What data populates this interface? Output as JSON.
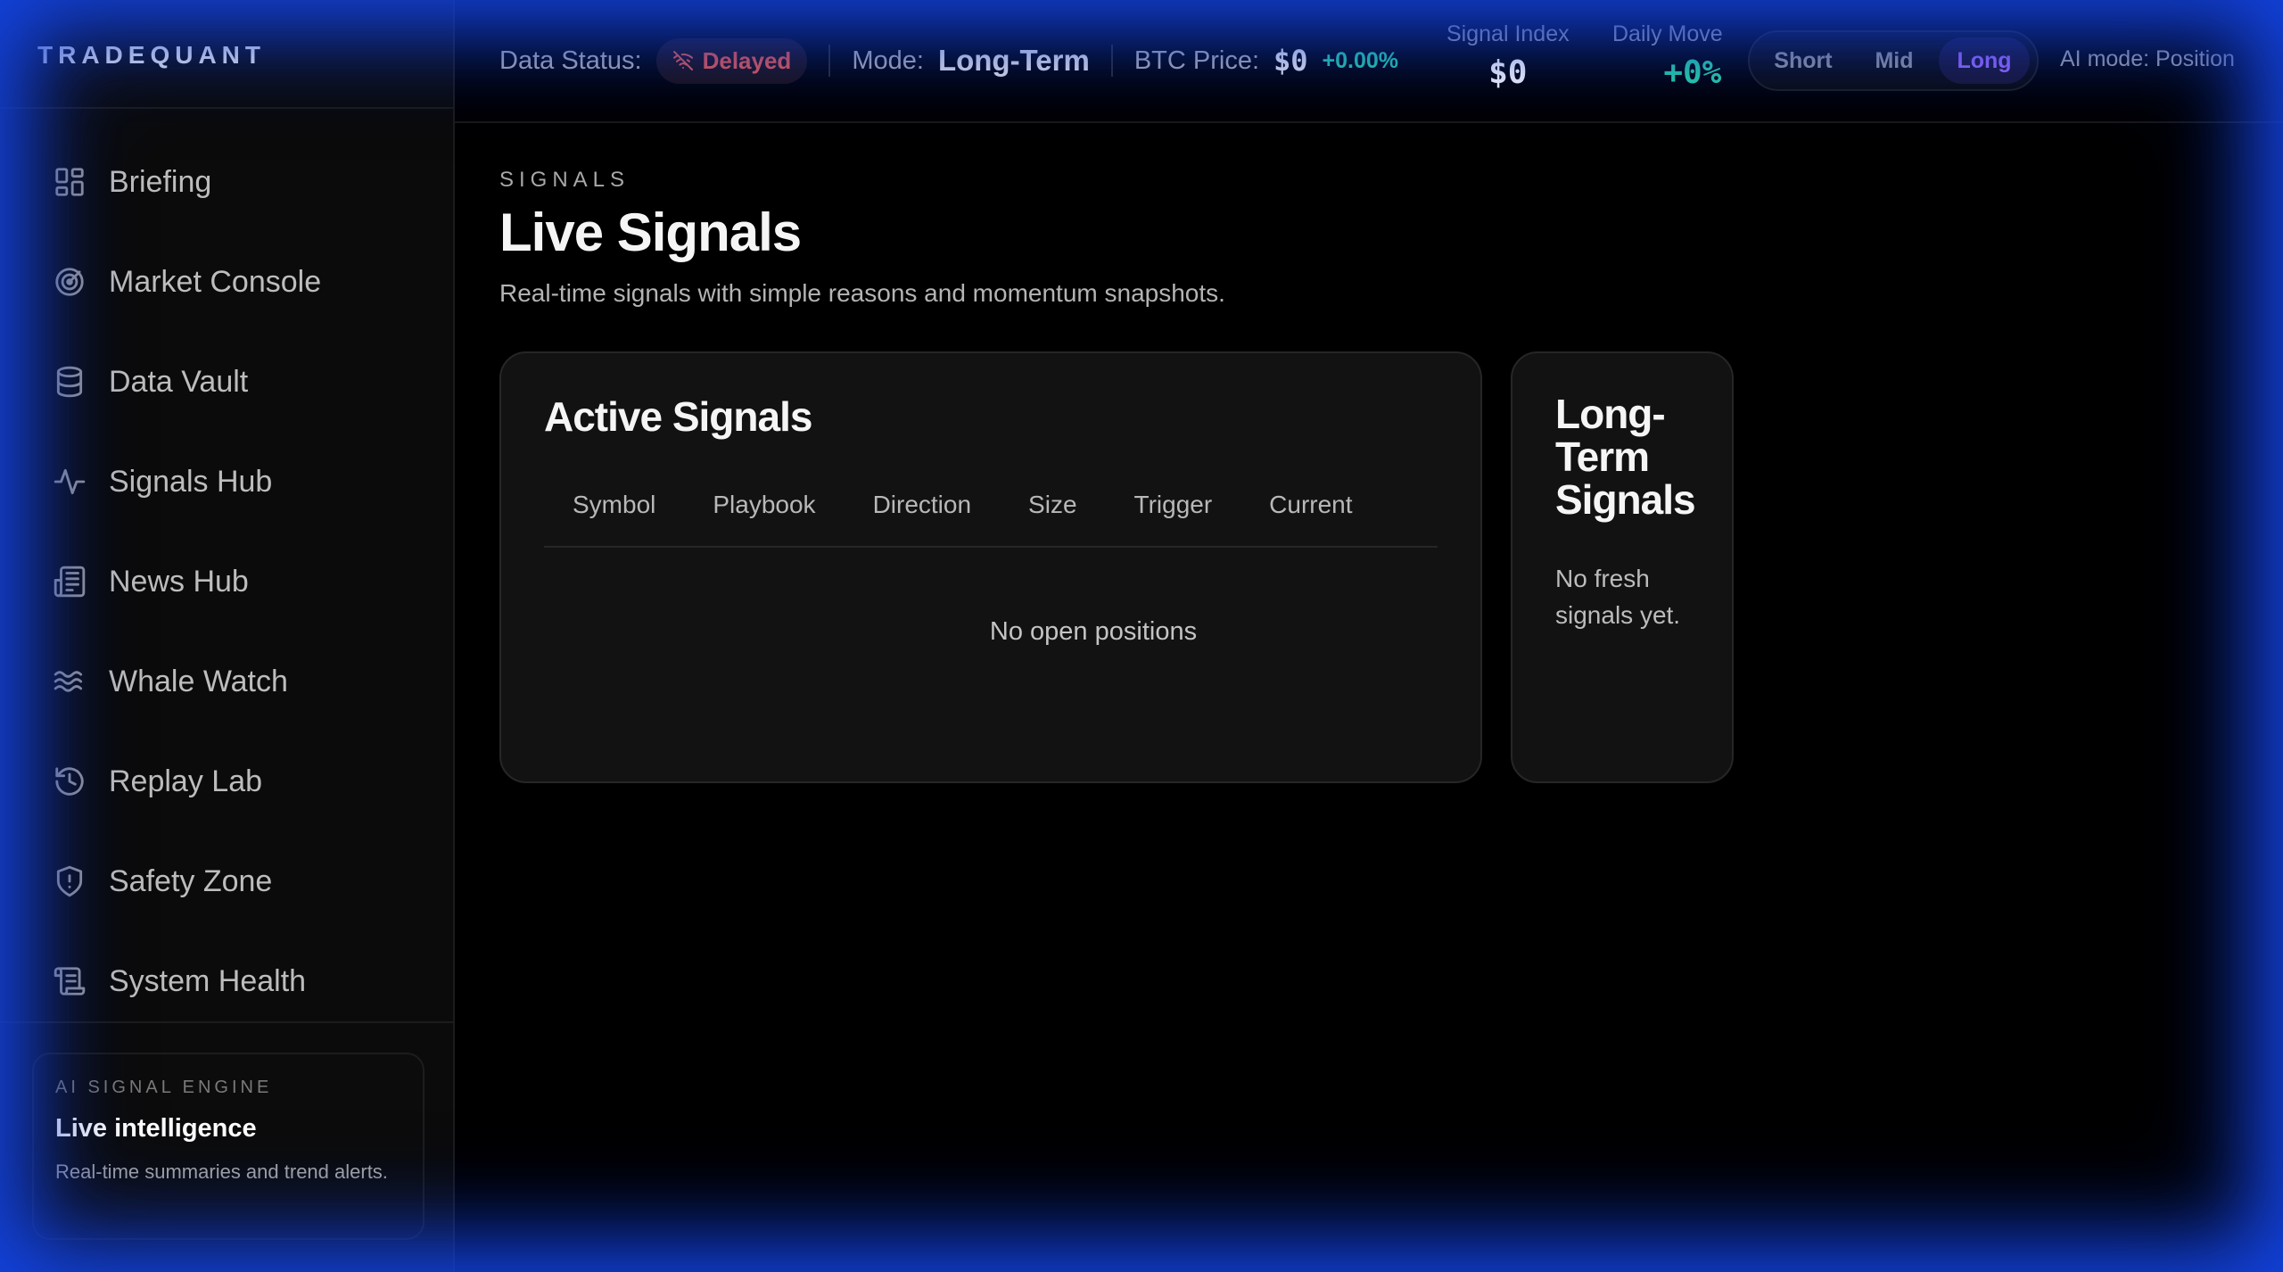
{
  "brand": "TRADEQUANT",
  "sidebar": {
    "items": [
      {
        "label": "Briefing",
        "icon": "grid-icon"
      },
      {
        "label": "Market Console",
        "icon": "radar-icon"
      },
      {
        "label": "Data Vault",
        "icon": "database-icon"
      },
      {
        "label": "Signals Hub",
        "icon": "activity-icon"
      },
      {
        "label": "News Hub",
        "icon": "newspaper-icon"
      },
      {
        "label": "Whale Watch",
        "icon": "waves-icon"
      },
      {
        "label": "Replay Lab",
        "icon": "history-icon"
      },
      {
        "label": "Safety Zone",
        "icon": "shield-icon"
      },
      {
        "label": "System Health",
        "icon": "scroll-icon"
      }
    ],
    "engine": {
      "eyebrow": "AI SIGNAL ENGINE",
      "title": "Live intelligence",
      "description": "Real-time summaries and trend alerts."
    }
  },
  "topbar": {
    "data_status_label": "Data Status:",
    "data_status_value": "Delayed",
    "mode_label": "Mode:",
    "mode_value": "Long-Term",
    "btc_label": "BTC Price:",
    "btc_value": "$0",
    "btc_change": "+0.00%",
    "signal_index_label": "Signal Index",
    "signal_index_value": "$0",
    "daily_move_label": "Daily Move",
    "daily_move_value": "+0%",
    "horizon": {
      "options": [
        "Short",
        "Mid",
        "Long"
      ],
      "selected": "Long"
    },
    "ai_mode": "AI mode: Position"
  },
  "page": {
    "eyebrow": "SIGNALS",
    "title": "Live Signals",
    "subtitle": "Real-time signals with simple reasons and momentum snapshots."
  },
  "active_signals": {
    "title": "Active Signals",
    "columns": [
      "Symbol",
      "Playbook",
      "Direction",
      "Size",
      "Trigger",
      "Current"
    ],
    "empty_text": "No open positions"
  },
  "long_term": {
    "title": "Long-Term Signals",
    "empty_text": "No fresh signals yet."
  },
  "colors": {
    "status_delayed": "#ef5a4a",
    "positive": "#2ad6a6",
    "accent_purple": "#a06bff",
    "edge_glow": "#1446e6"
  }
}
